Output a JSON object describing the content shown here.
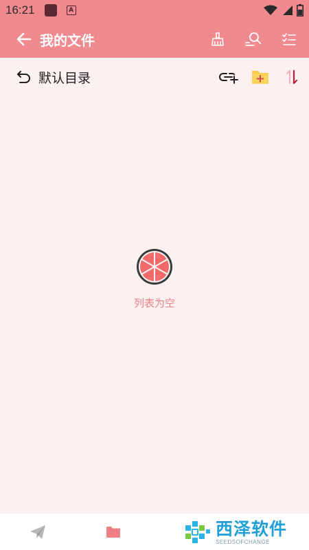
{
  "status_bar": {
    "time": "16:21",
    "notification_icons": [
      "app-icon",
      "a-icon"
    ],
    "right_icons": [
      "wifi-icon",
      "signal-icon",
      "battery-icon"
    ]
  },
  "app_bar": {
    "title": "我的文件",
    "actions": [
      "broom-icon",
      "user-search-icon",
      "checklist-icon"
    ]
  },
  "path_bar": {
    "label": "默认目录",
    "actions": [
      "link-add-icon",
      "folder-add-icon",
      "sort-icon"
    ]
  },
  "empty_state": {
    "icon": "grapefruit-icon",
    "text": "列表为空"
  },
  "bottom_nav": {
    "items": [
      "send-icon",
      "folder-icon"
    ]
  },
  "watermark": {
    "text": "西泽软件",
    "subtext": "SEEDSOFCHANGE"
  },
  "colors": {
    "primary": "#f08a8f",
    "background": "#fdf0f0",
    "empty_text": "#e78086",
    "watermark": "#1f9fd8"
  }
}
